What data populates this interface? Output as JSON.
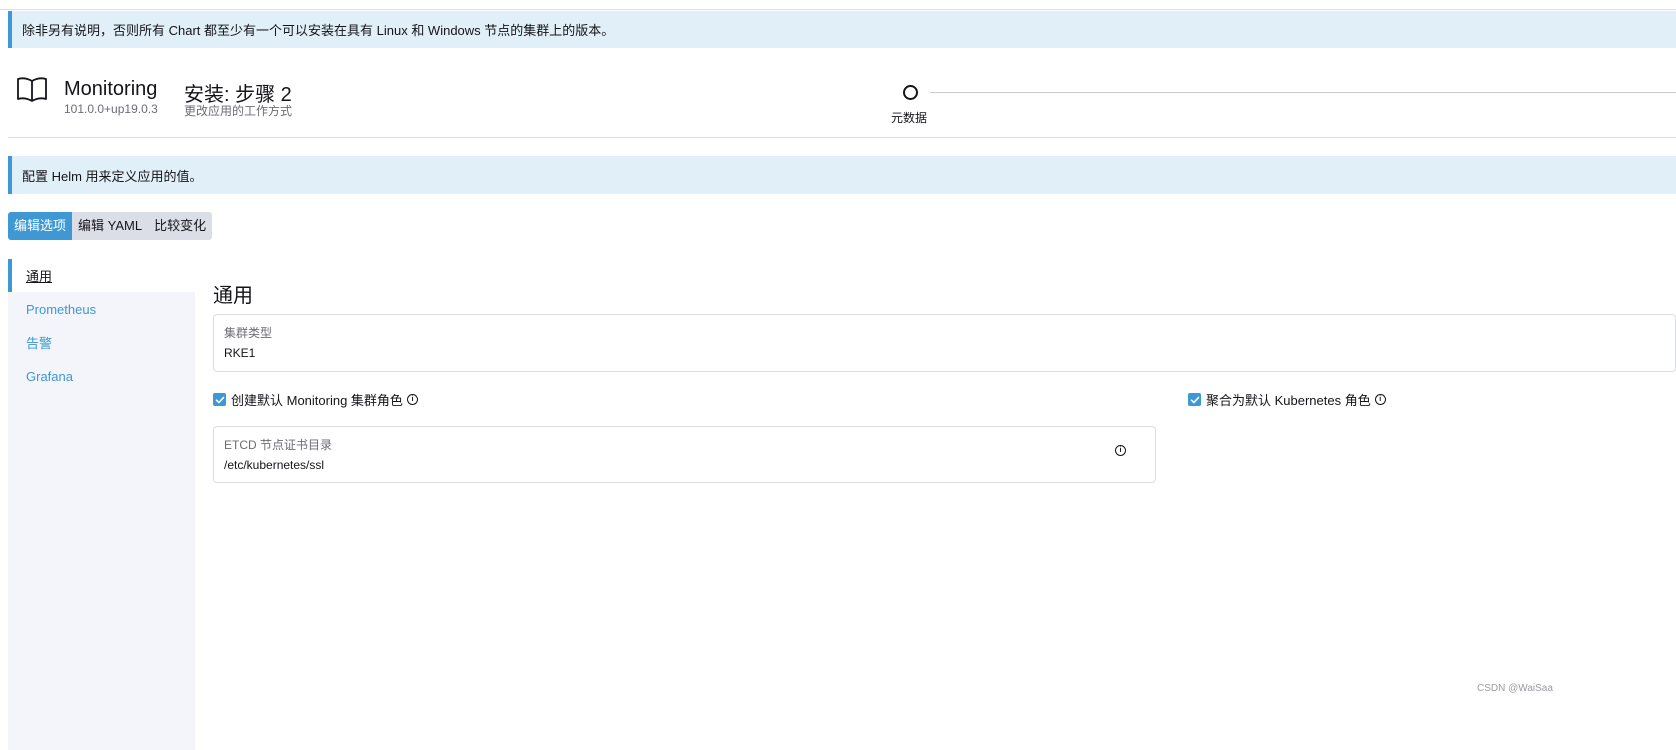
{
  "banner_top": "除非另有说明，否则所有 Chart 都至少有一个可以安装在具有 Linux 和 Windows 节点的集群上的版本。",
  "header": {
    "app_name": "Monitoring",
    "app_version": "101.0.0+up19.0.3",
    "step_title": "安装: 步骤 2",
    "step_subtitle": "更改应用的工作方式",
    "stepper_label": "元数据",
    "icon": "book-open-icon"
  },
  "banner_helm": "配置 Helm 用来定义应用的值。",
  "tabs": [
    {
      "label": "编辑选项",
      "active": true
    },
    {
      "label": "编辑 YAML",
      "active": false
    },
    {
      "label": "比较变化",
      "active": false
    }
  ],
  "sidebar": {
    "items": [
      {
        "label": "通用",
        "active": true
      },
      {
        "label": "Prometheus",
        "active": false
      },
      {
        "label": "告警",
        "active": false
      },
      {
        "label": "Grafana",
        "active": false
      }
    ]
  },
  "section": {
    "title": "通用",
    "cluster_type": {
      "label": "集群类型",
      "value": "RKE1"
    },
    "create_default_roles": {
      "label": "创建默认 Monitoring 集群角色",
      "checked": true
    },
    "aggregate_roles": {
      "label": "聚合为默认 Kubernetes 角色",
      "checked": true
    },
    "etcd_dir": {
      "label": "ETCD 节点证书目录",
      "value": "/etc/kubernetes/ssl"
    }
  },
  "watermark": "CSDN @WaiSaa",
  "colors": {
    "accent": "#3d98d3",
    "banner_bg": "#e1f0f8",
    "sidebar_bg": "#f4f5fa"
  }
}
